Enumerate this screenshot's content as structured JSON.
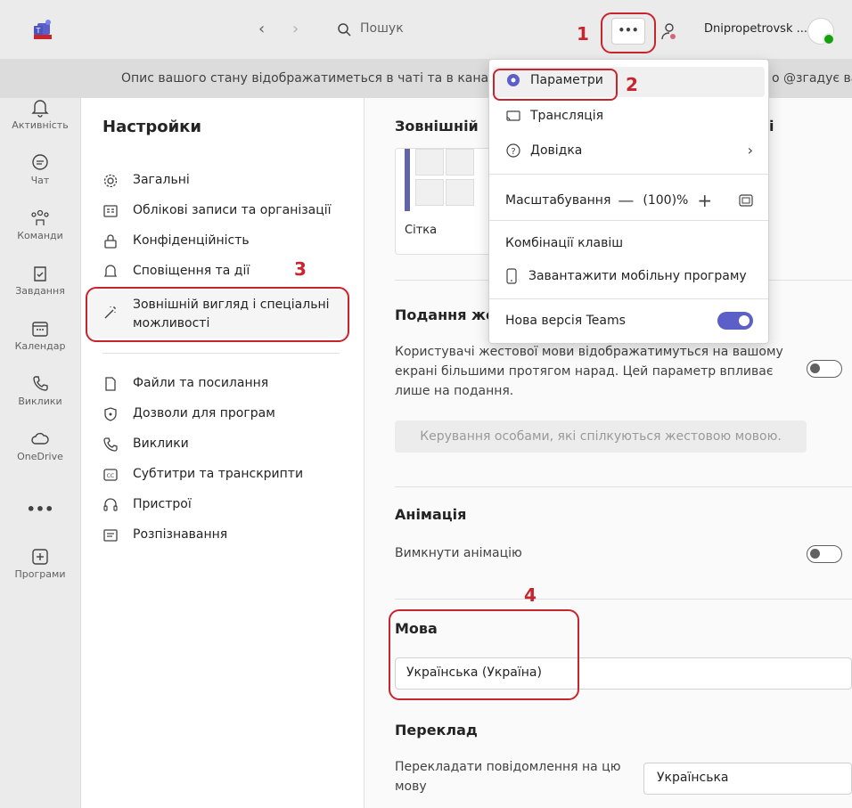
{
  "topbar": {
    "search_placeholder": "Пошук",
    "more_label": "•••",
    "account_name": "Dnipropetrovsk ..."
  },
  "banner": {
    "text": "Опис вашого стану відображатиметься в чаті та в каналах",
    "text_right": "о @згадує ва"
  },
  "rail": {
    "items": [
      {
        "label": "Активність",
        "icon": "bell-icon"
      },
      {
        "label": "Чат",
        "icon": "chat-icon"
      },
      {
        "label": "Команди",
        "icon": "teams-icon"
      },
      {
        "label": "Завдання",
        "icon": "tasks-icon"
      },
      {
        "label": "Календар",
        "icon": "calendar-icon"
      },
      {
        "label": "Виклики",
        "icon": "phone-icon"
      },
      {
        "label": "OneDrive",
        "icon": "cloud-icon"
      },
      {
        "label": "•••",
        "icon": "more-icon"
      },
      {
        "label": "Програми",
        "icon": "plus-square-icon"
      }
    ]
  },
  "settings": {
    "title": "Настройки",
    "items": [
      {
        "label": "Загальні",
        "icon": "gear-icon"
      },
      {
        "label": "Облікові записи та організації",
        "icon": "id-card-icon"
      },
      {
        "label": "Конфіденційність",
        "icon": "lock-icon"
      },
      {
        "label": "Сповіщення та дії",
        "icon": "bell-icon"
      },
      {
        "label": "Зовнішній вигляд і спеціальні можливості",
        "line1": "Зовнішній вигляд і спеціальні",
        "line2": "можливості",
        "icon": "magic-wand-icon"
      },
      {
        "label": "Файли та посилання",
        "icon": "file-icon"
      },
      {
        "label": "Дозволи для програм",
        "icon": "shield-icon"
      },
      {
        "label": "Виклики",
        "icon": "phone-icon"
      },
      {
        "label": "Субтитри та транскрипти",
        "icon": "cc-icon"
      },
      {
        "label": "Пристрої",
        "icon": "headset-icon"
      },
      {
        "label": "Розпізнавання",
        "icon": "text-doc-icon"
      }
    ]
  },
  "main": {
    "appearance_title": "Зовнішній",
    "appearance_title_tail": "і",
    "grid_label": "Сітка",
    "sign_title": "Подання же",
    "sign_desc": "Користувачі жестової мови відображатимуться на вашому екрані більшими протягом нарад. Цей параметр впливає лише на подання.",
    "sign_desc_lines": [
      "Користувачі жестової мови відображатимуться на вашому",
      "екрані більшими протягом нарад. Цей параметр впливає",
      "лише на подання."
    ],
    "sign_button": "Керування особами, які спілкуються жестовою мовою.",
    "animation_title": "Анімація",
    "animation_label": "Вимкнути анімацію",
    "language_title": "Мова",
    "language_value": "Українська (Україна)",
    "translation_title": "Переклад",
    "translation_label_lines": [
      "Перекладати повідомлення на цю",
      "мову"
    ],
    "translation_value": "Українська"
  },
  "menu": {
    "settings": "Параметри",
    "broadcast": "Трансляція",
    "help": "Довідка",
    "zoom_label": "Масштабування",
    "zoom_value": "(100)%",
    "shortcuts": "Комбінації клавіш",
    "download_mobile": "Завантажити мобільну програму",
    "new_teams": "Нова версія Teams"
  },
  "markers": [
    "1",
    "2",
    "3",
    "4"
  ],
  "colors": {
    "accent": "#5b5fc7",
    "annotation_red": "#c8242e"
  }
}
